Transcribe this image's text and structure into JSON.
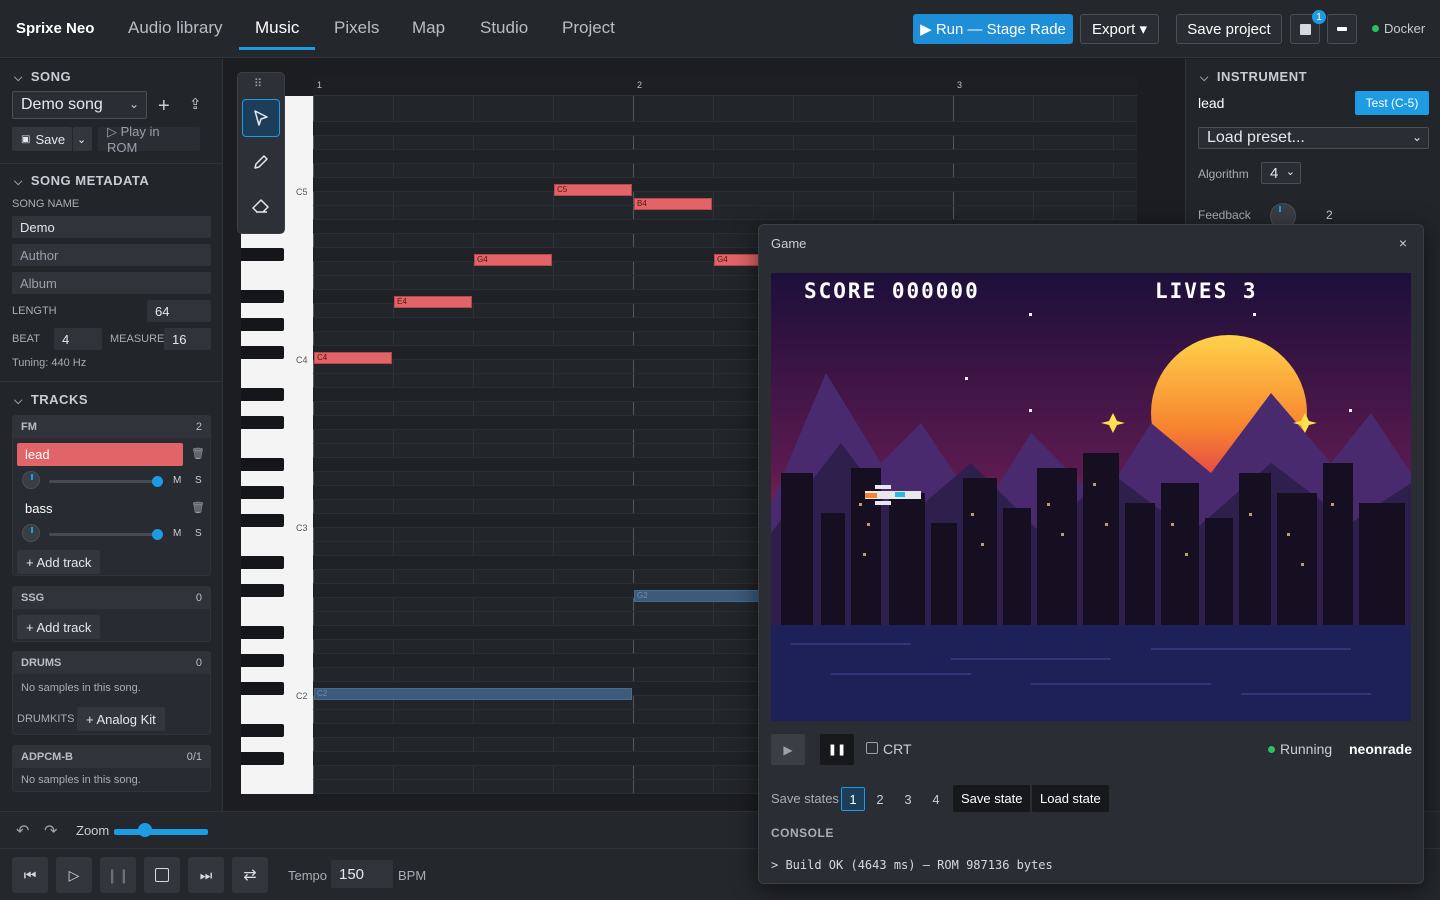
{
  "app": {
    "name": "Sprixe Neo"
  },
  "nav": {
    "tabs": [
      "Audio library",
      "Music",
      "Pixels",
      "Map",
      "Studio",
      "Project"
    ],
    "active": "Music"
  },
  "header": {
    "run_label": "▶ Run — Stage Rade",
    "export_label": "Export ▾",
    "save_label": "Save project",
    "notif_count": "1",
    "docker_label": "Docker"
  },
  "song": {
    "section": "SONG",
    "selected": "Demo song",
    "save_label": "Save",
    "play_rom_label": "▷ Play in ROM"
  },
  "metadata": {
    "section": "SONG METADATA",
    "song_name_label": "SONG NAME",
    "song_name": "Demo",
    "author_placeholder": "Author",
    "album_placeholder": "Album",
    "length_label": "LENGTH",
    "length": "64",
    "beat_label": "BEAT",
    "beat": "4",
    "measure_label": "MEASURE",
    "measure": "16",
    "tuning": "Tuning: 440 Hz"
  },
  "tracks": {
    "section": "TRACKS",
    "fm": {
      "label": "FM",
      "count": "2",
      "items": [
        {
          "name": "lead"
        },
        {
          "name": "bass"
        }
      ]
    },
    "ssg": {
      "label": "SSG",
      "count": "0"
    },
    "drums": {
      "label": "DRUMS",
      "count": "0",
      "empty": "No samples in this song.",
      "kits_label": "DRUMKITS",
      "kit_btn": "+ Analog Kit"
    },
    "adpcm": {
      "label": "ADPCM-B",
      "count": "0/1",
      "empty": "No samples in this song."
    },
    "add_track_label": "+ Add track",
    "mute": "M",
    "solo": "S"
  },
  "pianoroll": {
    "measures": [
      "1",
      "2",
      "3"
    ],
    "key_labels": [
      "C5",
      "C4",
      "C3",
      "C2"
    ],
    "notes": [
      {
        "label": "C5",
        "track": "lead"
      },
      {
        "label": "B4",
        "track": "lead"
      },
      {
        "label": "G4",
        "track": "lead"
      },
      {
        "label": "G4",
        "track": "lead"
      },
      {
        "label": "E4",
        "track": "lead"
      },
      {
        "label": "C4",
        "track": "lead"
      },
      {
        "label": "G2",
        "track": "bass"
      },
      {
        "label": "C2",
        "track": "bass"
      }
    ]
  },
  "transport": {
    "zoom_label": "Zoom",
    "tempo_label": "Tempo",
    "tempo": "150",
    "bpm": "BPM"
  },
  "instrument": {
    "section": "INSTRUMENT",
    "name": "lead",
    "test_label": "Test (C-5)",
    "preset_placeholder": "Load preset...",
    "algorithm_label": "Algorithm",
    "algorithm": "4",
    "feedback_label": "Feedback",
    "feedback": "2"
  },
  "game": {
    "title": "Game",
    "score": "SCORE 000000",
    "lives": "LIVES 3",
    "crt_label": "CRT",
    "status": "Running",
    "rom_name": "neonrade",
    "save_states_label": "Save states",
    "slots": [
      "1",
      "2",
      "3",
      "4"
    ],
    "save_state_label": "Save state",
    "load_state_label": "Load state",
    "console_label": "CONSOLE",
    "console_line": "> Build OK (4643 ms) — ROM 987136 bytes"
  },
  "colors": {
    "accent": "#1e9ce3",
    "lead_note": "#e06468",
    "bass_note": "#3c5a7a",
    "running": "#29c25c"
  }
}
